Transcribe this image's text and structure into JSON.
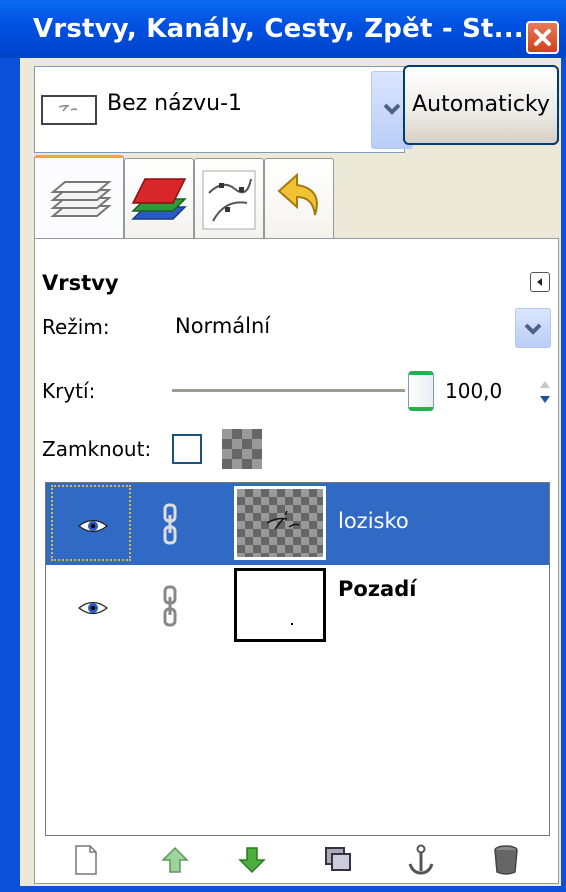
{
  "window": {
    "title": "Vrstvy, Kanály, Cesty, Zpět - St..."
  },
  "image_selector": {
    "name": "Bez názvu-1",
    "auto_label": "Automaticky"
  },
  "tabs": [
    {
      "name": "layers-tab",
      "icon": "layers-icon"
    },
    {
      "name": "channels-tab",
      "icon": "channels-icon"
    },
    {
      "name": "paths-tab",
      "icon": "paths-icon"
    },
    {
      "name": "undo-history-tab",
      "icon": "undo-icon"
    }
  ],
  "panel": {
    "title": "Vrstvy",
    "mode_label": "Režim:",
    "mode_value": "Normální",
    "opacity_label": "Krytí:",
    "opacity_value": "100,0",
    "opacity_fraction": 1.0,
    "lock_label": "Zamknout:"
  },
  "layers": [
    {
      "name": "lozisko",
      "visible": true,
      "selected": true,
      "bold": false
    },
    {
      "name": "Pozadí",
      "visible": true,
      "selected": false,
      "bold": true
    }
  ],
  "bottom_buttons": [
    "new-layer-icon",
    "raise-layer-icon",
    "lower-layer-icon",
    "duplicate-layer-icon",
    "anchor-layer-icon",
    "delete-layer-icon"
  ],
  "colors": {
    "titlebar": "#0050e0",
    "selection": "#316ac5",
    "active_tab": "#f5a623"
  }
}
